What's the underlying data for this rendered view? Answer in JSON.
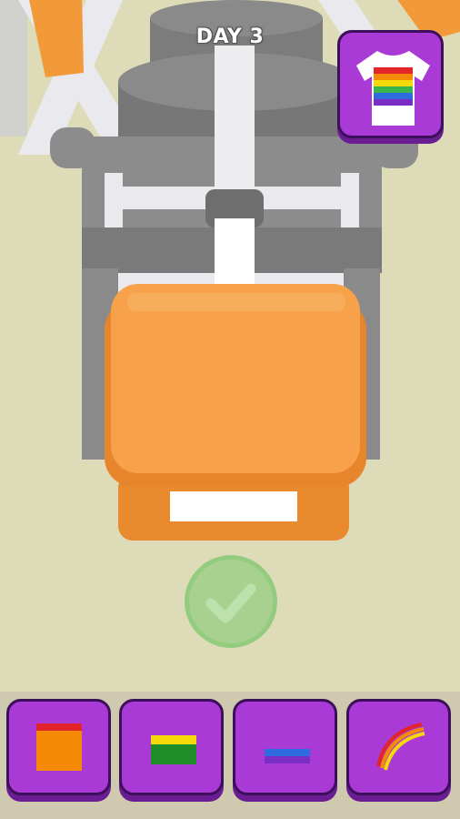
{
  "hud": {
    "day_label": "DAY 3"
  },
  "target_design": {
    "icon": "rainbow-shirt-icon",
    "stripe_colors": [
      "#e3242b",
      "#f58a07",
      "#f5d90a",
      "#39b54a",
      "#2e6bde",
      "#7a2fc4"
    ]
  },
  "confirm_button": {
    "icon": "checkmark-icon",
    "color": "#96cd82"
  },
  "toolbar": {
    "tools": [
      {
        "icon": "orange-block-red-top-icon",
        "colors": [
          "#f58a07",
          "#e3242b"
        ]
      },
      {
        "icon": "yellow-green-block-icon",
        "colors": [
          "#f5d90a",
          "#1f8c2a"
        ]
      },
      {
        "icon": "blue-purple-stripe-icon",
        "colors": [
          "#2e6bde",
          "#7a2fc4"
        ]
      },
      {
        "icon": "rainbow-arc-icon",
        "colors": [
          "#f5d90a",
          "#f58a07",
          "#e3242b"
        ]
      }
    ]
  },
  "colors": {
    "button_purple": "#a93ad6",
    "button_border": "#3c0f5a",
    "press_orange": "#f7a24a",
    "floor": "#dedcb8",
    "machine_gray": "#8a8a8a"
  }
}
